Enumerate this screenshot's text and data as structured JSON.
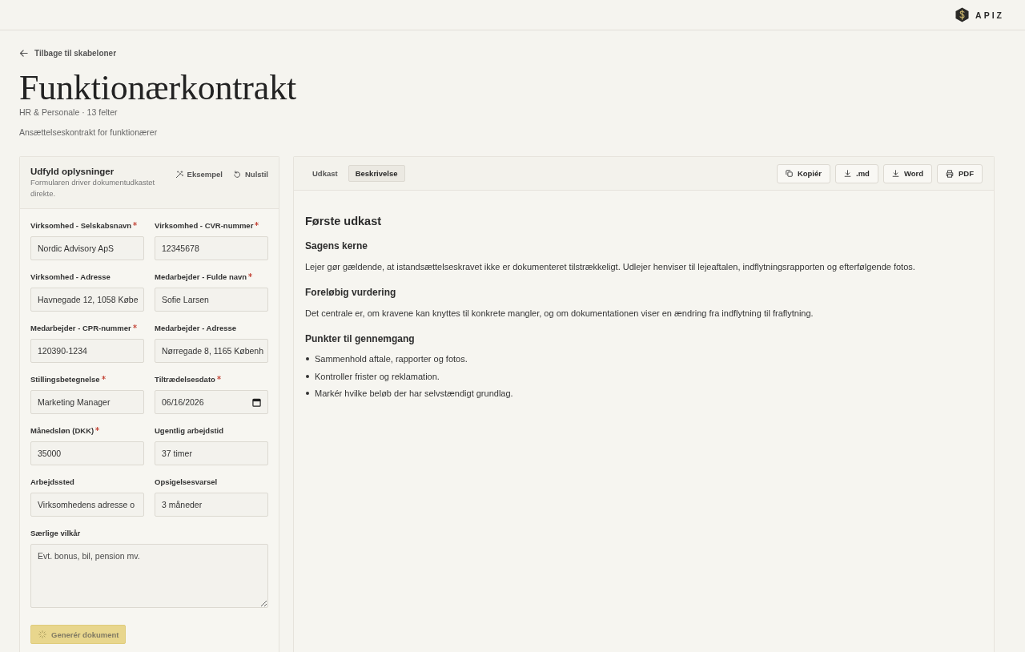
{
  "top_bar": {
    "brand": "APIZ"
  },
  "header": {
    "back_link": "Tilbage til skabeloner",
    "title": "Funktionærkontrakt",
    "meta": "HR & Personale · 13 felter",
    "description": "Ansættelseskontrakt for funktionærer"
  },
  "form_panel": {
    "title": "Udfyld oplysninger",
    "subtitle": "Formularen driver dokumentudkastet direkte.",
    "actions": [
      {
        "label": "Eksempel",
        "kind": "example"
      },
      {
        "label": "Nulstil",
        "kind": "reset"
      }
    ],
    "fields": [
      {
        "label": "Virksomhed - Selskabsnavn",
        "required": true,
        "kind": "text",
        "value": "Nordic Advisory ApS"
      },
      {
        "label": "Virksomhed - CVR-nummer",
        "required": true,
        "kind": "text",
        "value": "12345678"
      },
      {
        "label": "Virksomhed - Adresse",
        "required": false,
        "kind": "text",
        "value": "Havnegade 12, 1058 Købe"
      },
      {
        "label": "Medarbejder - Fulde navn",
        "required": true,
        "kind": "text",
        "value": "Sofie Larsen"
      },
      {
        "label": "Medarbejder - CPR-nummer",
        "required": true,
        "kind": "text",
        "value": "120390-1234"
      },
      {
        "label": "Medarbejder - Adresse",
        "required": false,
        "kind": "text",
        "value": "Nørregade 8, 1165 Københ"
      },
      {
        "label": "Stillingsbetegnelse",
        "required": true,
        "kind": "text",
        "value": "Marketing Manager"
      },
      {
        "label": "Tiltrædelsesdato",
        "required": true,
        "kind": "date",
        "value": "06/16/2026"
      },
      {
        "label": "Månedsløn (DKK)",
        "required": true,
        "kind": "text",
        "value": "35000"
      },
      {
        "label": "Ugentlig arbejdstid",
        "required": false,
        "kind": "text",
        "value": "37 timer"
      },
      {
        "label": "Arbejdssted",
        "required": false,
        "kind": "text",
        "value": "Virksomhedens adresse o"
      },
      {
        "label": "Opsigelsesvarsel",
        "required": false,
        "kind": "text",
        "value": "3 måneder"
      },
      {
        "label": "Særlige vilkår",
        "required": false,
        "kind": "textarea",
        "placeholder": "Evt. bonus, bil, pension mv."
      }
    ],
    "submit": {
      "label": "Generér dokument",
      "disabled": true
    }
  },
  "preview_panel": {
    "tabs": [
      {
        "label": "Udkast",
        "selected": false
      },
      {
        "label": "Beskrivelse",
        "selected": true
      }
    ],
    "actions": [
      {
        "label": "Kopiér",
        "kind": "copy"
      },
      {
        "label": ".md",
        "kind": "download"
      },
      {
        "label": "Word",
        "kind": "download"
      },
      {
        "label": "PDF",
        "kind": "print"
      }
    ],
    "document": {
      "title": "Første udkast",
      "sections": [
        {
          "heading": "Sagens kerne",
          "kind": "paragraph",
          "text": "Lejer gør gældende, at istandsættelseskravet ikke er dokumenteret tilstrækkeligt. Udlejer henviser til lejeaftalen, indflytningsrapporten og efterfølgende fotos."
        },
        {
          "heading": "Foreløbig vurdering",
          "kind": "paragraph",
          "text": "Det centrale er, om kravene kan knyttes til konkrete mangler, og om dokumentationen viser en ændring fra indflytning til fraflytning."
        },
        {
          "heading": "Punkter til gennemgang",
          "kind": "list",
          "items": [
            "Sammenhold aftale, rapporter og fotos.",
            "Kontroller frister og reklamation.",
            "Markér hvilke beløb der har selvstændigt grundlag."
          ]
        }
      ]
    }
  }
}
